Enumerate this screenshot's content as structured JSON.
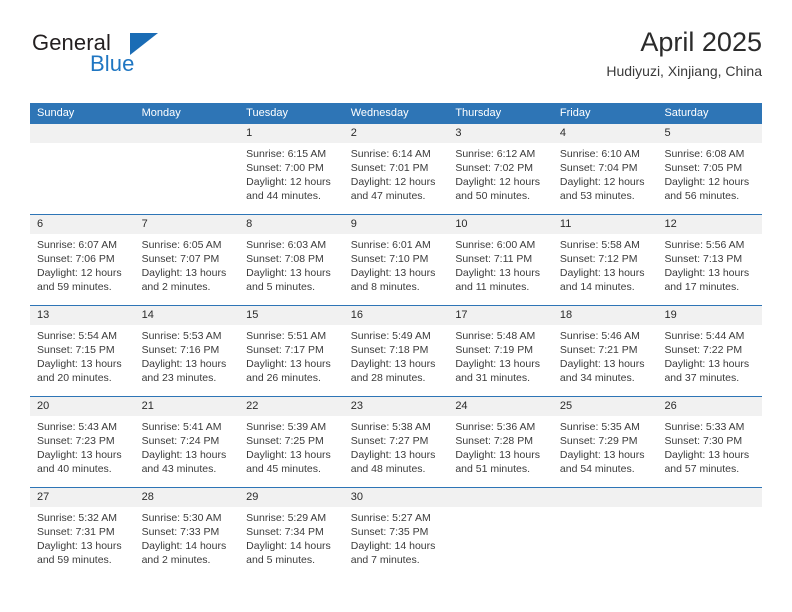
{
  "brand": {
    "name_top": "General",
    "name_bottom": "Blue",
    "accent_color": "#1a6cb5",
    "text_color": "#231f20"
  },
  "header": {
    "title": "April 2025",
    "subtitle": "Hudiyuzi, Xinjiang, China"
  },
  "theme": {
    "header_bar_color": "#2e75b6",
    "daynum_row_color": "#f1f1f1",
    "grid_line_color": "#2e75b6",
    "body_text_color": "#3b3b3b"
  },
  "weekdays": [
    "Sunday",
    "Monday",
    "Tuesday",
    "Wednesday",
    "Thursday",
    "Friday",
    "Saturday"
  ],
  "labels": {
    "sunrise": "Sunrise:",
    "sunset": "Sunset:",
    "daylight": "Daylight:"
  },
  "weeks": [
    {
      "days": [
        {
          "num": "",
          "l1": "",
          "l2": "",
          "l3": "",
          "empty": true
        },
        {
          "num": "",
          "l1": "",
          "l2": "",
          "l3": "",
          "empty": true
        },
        {
          "num": "1",
          "l1": "Sunrise: 6:15 AM",
          "l2": "Sunset: 7:00 PM",
          "l3": "Daylight: 12 hours and 44 minutes."
        },
        {
          "num": "2",
          "l1": "Sunrise: 6:14 AM",
          "l2": "Sunset: 7:01 PM",
          "l3": "Daylight: 12 hours and 47 minutes."
        },
        {
          "num": "3",
          "l1": "Sunrise: 6:12 AM",
          "l2": "Sunset: 7:02 PM",
          "l3": "Daylight: 12 hours and 50 minutes."
        },
        {
          "num": "4",
          "l1": "Sunrise: 6:10 AM",
          "l2": "Sunset: 7:04 PM",
          "l3": "Daylight: 12 hours and 53 minutes."
        },
        {
          "num": "5",
          "l1": "Sunrise: 6:08 AM",
          "l2": "Sunset: 7:05 PM",
          "l3": "Daylight: 12 hours and 56 minutes."
        }
      ]
    },
    {
      "days": [
        {
          "num": "6",
          "l1": "Sunrise: 6:07 AM",
          "l2": "Sunset: 7:06 PM",
          "l3": "Daylight: 12 hours and 59 minutes."
        },
        {
          "num": "7",
          "l1": "Sunrise: 6:05 AM",
          "l2": "Sunset: 7:07 PM",
          "l3": "Daylight: 13 hours and 2 minutes."
        },
        {
          "num": "8",
          "l1": "Sunrise: 6:03 AM",
          "l2": "Sunset: 7:08 PM",
          "l3": "Daylight: 13 hours and 5 minutes."
        },
        {
          "num": "9",
          "l1": "Sunrise: 6:01 AM",
          "l2": "Sunset: 7:10 PM",
          "l3": "Daylight: 13 hours and 8 minutes."
        },
        {
          "num": "10",
          "l1": "Sunrise: 6:00 AM",
          "l2": "Sunset: 7:11 PM",
          "l3": "Daylight: 13 hours and 11 minutes."
        },
        {
          "num": "11",
          "l1": "Sunrise: 5:58 AM",
          "l2": "Sunset: 7:12 PM",
          "l3": "Daylight: 13 hours and 14 minutes."
        },
        {
          "num": "12",
          "l1": "Sunrise: 5:56 AM",
          "l2": "Sunset: 7:13 PM",
          "l3": "Daylight: 13 hours and 17 minutes."
        }
      ]
    },
    {
      "days": [
        {
          "num": "13",
          "l1": "Sunrise: 5:54 AM",
          "l2": "Sunset: 7:15 PM",
          "l3": "Daylight: 13 hours and 20 minutes."
        },
        {
          "num": "14",
          "l1": "Sunrise: 5:53 AM",
          "l2": "Sunset: 7:16 PM",
          "l3": "Daylight: 13 hours and 23 minutes."
        },
        {
          "num": "15",
          "l1": "Sunrise: 5:51 AM",
          "l2": "Sunset: 7:17 PM",
          "l3": "Daylight: 13 hours and 26 minutes."
        },
        {
          "num": "16",
          "l1": "Sunrise: 5:49 AM",
          "l2": "Sunset: 7:18 PM",
          "l3": "Daylight: 13 hours and 28 minutes."
        },
        {
          "num": "17",
          "l1": "Sunrise: 5:48 AM",
          "l2": "Sunset: 7:19 PM",
          "l3": "Daylight: 13 hours and 31 minutes."
        },
        {
          "num": "18",
          "l1": "Sunrise: 5:46 AM",
          "l2": "Sunset: 7:21 PM",
          "l3": "Daylight: 13 hours and 34 minutes."
        },
        {
          "num": "19",
          "l1": "Sunrise: 5:44 AM",
          "l2": "Sunset: 7:22 PM",
          "l3": "Daylight: 13 hours and 37 minutes."
        }
      ]
    },
    {
      "days": [
        {
          "num": "20",
          "l1": "Sunrise: 5:43 AM",
          "l2": "Sunset: 7:23 PM",
          "l3": "Daylight: 13 hours and 40 minutes."
        },
        {
          "num": "21",
          "l1": "Sunrise: 5:41 AM",
          "l2": "Sunset: 7:24 PM",
          "l3": "Daylight: 13 hours and 43 minutes."
        },
        {
          "num": "22",
          "l1": "Sunrise: 5:39 AM",
          "l2": "Sunset: 7:25 PM",
          "l3": "Daylight: 13 hours and 45 minutes."
        },
        {
          "num": "23",
          "l1": "Sunrise: 5:38 AM",
          "l2": "Sunset: 7:27 PM",
          "l3": "Daylight: 13 hours and 48 minutes."
        },
        {
          "num": "24",
          "l1": "Sunrise: 5:36 AM",
          "l2": "Sunset: 7:28 PM",
          "l3": "Daylight: 13 hours and 51 minutes."
        },
        {
          "num": "25",
          "l1": "Sunrise: 5:35 AM",
          "l2": "Sunset: 7:29 PM",
          "l3": "Daylight: 13 hours and 54 minutes."
        },
        {
          "num": "26",
          "l1": "Sunrise: 5:33 AM",
          "l2": "Sunset: 7:30 PM",
          "l3": "Daylight: 13 hours and 57 minutes."
        }
      ]
    },
    {
      "days": [
        {
          "num": "27",
          "l1": "Sunrise: 5:32 AM",
          "l2": "Sunset: 7:31 PM",
          "l3": "Daylight: 13 hours and 59 minutes."
        },
        {
          "num": "28",
          "l1": "Sunrise: 5:30 AM",
          "l2": "Sunset: 7:33 PM",
          "l3": "Daylight: 14 hours and 2 minutes."
        },
        {
          "num": "29",
          "l1": "Sunrise: 5:29 AM",
          "l2": "Sunset: 7:34 PM",
          "l3": "Daylight: 14 hours and 5 minutes."
        },
        {
          "num": "30",
          "l1": "Sunrise: 5:27 AM",
          "l2": "Sunset: 7:35 PM",
          "l3": "Daylight: 14 hours and 7 minutes."
        },
        {
          "num": "",
          "l1": "",
          "l2": "",
          "l3": "",
          "empty": true
        },
        {
          "num": "",
          "l1": "",
          "l2": "",
          "l3": "",
          "empty": true
        },
        {
          "num": "",
          "l1": "",
          "l2": "",
          "l3": "",
          "empty": true
        }
      ]
    }
  ]
}
